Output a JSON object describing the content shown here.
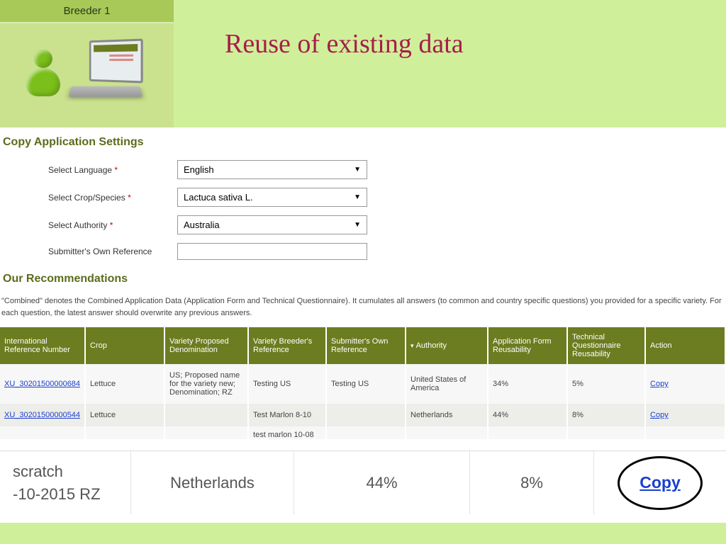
{
  "header": {
    "breeder_title": "Breeder 1",
    "slide_title": "Reuse of existing data"
  },
  "form": {
    "section_title": "Copy Application Settings",
    "language_label": "Select Language",
    "language_value": "English",
    "crop_label": "Select Crop/Species",
    "crop_value": "Lactuca sativa L.",
    "authority_label": "Select Authority",
    "authority_value": "Australia",
    "ref_label": "Submitter's Own Reference",
    "ref_value": ""
  },
  "recommendations": {
    "title": "Our Recommendations",
    "description": "\"Combined\" denotes the Combined Application Data (Application Form and Technical Questionnaire). It cumulates all answers (to common and country specific questions) you provided for a specific variety. For each question, the latest answer should overwrite any previous answers."
  },
  "table": {
    "headers": {
      "ref": "International Reference Number",
      "crop": "Crop",
      "denom": "Variety Proposed Denomination",
      "breeder_ref": "Variety Breeder's Reference",
      "sub_ref": "Submitter's Own Reference",
      "authority": "Authority",
      "app_reuse": "Application Form Reusability",
      "tq_reuse": "Technical Questionnaire Reusability",
      "action": "Action"
    },
    "rows": [
      {
        "ref": "XU_30201500000684",
        "crop": "Lettuce",
        "denom": "US; Proposed name for the variety new; Denomination; RZ",
        "breeder_ref": "Testing US",
        "sub_ref": "Testing US",
        "authority": "United States of America",
        "app_reuse": "34%",
        "tq_reuse": "5%",
        "action": "Copy"
      },
      {
        "ref": "XU_30201500000544",
        "crop": "Lettuce",
        "denom": "",
        "breeder_ref": "Test Marlon 8-10",
        "sub_ref": "",
        "authority": "Netherlands",
        "app_reuse": "44%",
        "tq_reuse": "8%",
        "action": "Copy"
      }
    ],
    "partial": {
      "breeder_ref": "test marlon 10-08"
    }
  },
  "zoom": {
    "c1a": "scratch",
    "c1b": "-10-2015 RZ",
    "c2": "Netherlands",
    "c3": "44%",
    "c4": "8%",
    "c5": "Copy"
  }
}
